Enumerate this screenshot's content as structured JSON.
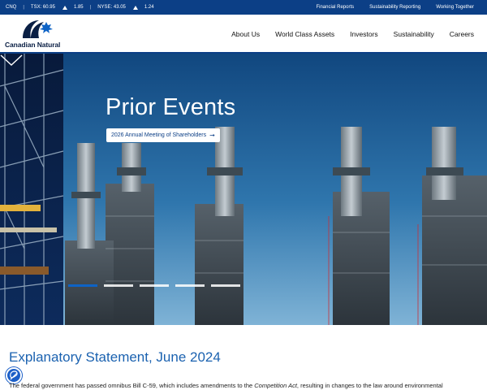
{
  "ticker": {
    "symbol": "CNQ",
    "tsx_label": "TSX: 60.95",
    "tsx_change": "1.85",
    "nyse_label": "NYSE: 43.05",
    "nyse_change": "1.24",
    "sep": "|"
  },
  "top_links": [
    "Financial Reports",
    "Sustainability Reporting",
    "Working Together"
  ],
  "brand": {
    "name": "Canadian Natural"
  },
  "nav": [
    "About Us",
    "World Class Assets",
    "Investors",
    "Sustainability",
    "Careers"
  ],
  "hero": {
    "title": "Prior Events",
    "button_label": "2026 Annual Meeting of Shareholders",
    "button_arrow": "➞",
    "slide_count": 5,
    "active_slide": 1
  },
  "content": {
    "title": "Explanatory Statement, June 2024",
    "body_before": "The federal government has passed omnibus Bill C-59, which includes amendments to the ",
    "body_em": "Competition Act",
    "body_after": ", resulting in changes to the law around environmental"
  },
  "colors": {
    "brand_blue": "#0c3f86",
    "heading_blue": "#1b62b0",
    "slide_active": "#0e63c6"
  }
}
